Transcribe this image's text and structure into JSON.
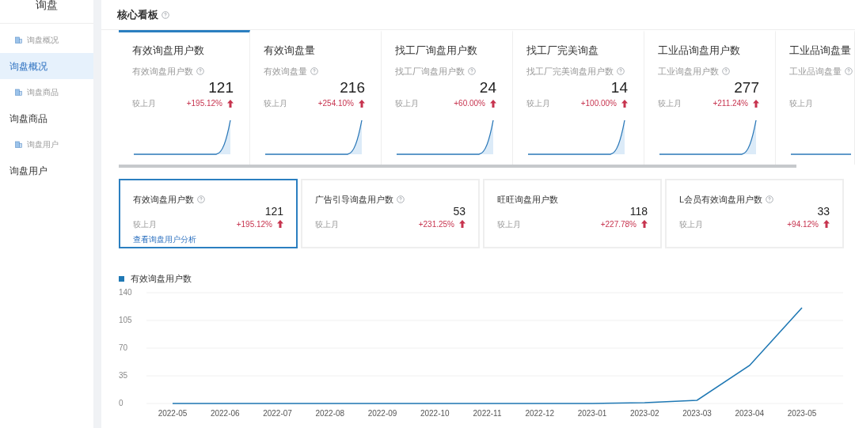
{
  "sidebar": {
    "title": "询盘",
    "items": [
      {
        "label": "询盘概况",
        "kind": "sub",
        "selected": false
      },
      {
        "label": "询盘概况",
        "kind": "main",
        "selected": true
      },
      {
        "label": "询盘商品",
        "kind": "sub",
        "selected": false
      },
      {
        "label": "询盘商品",
        "kind": "main",
        "selected": false
      },
      {
        "label": "询盘用户",
        "kind": "sub",
        "selected": false
      },
      {
        "label": "询盘用户",
        "kind": "main",
        "selected": false
      }
    ]
  },
  "header": {
    "title": "核心看板"
  },
  "metric_cards": [
    {
      "title": "有效询盘用户数",
      "subtitle": "有效询盘用户数",
      "value": "121",
      "compare_label": "较上月",
      "change": "+195.12%",
      "selected": true
    },
    {
      "title": "有效询盘量",
      "subtitle": "有效询盘量",
      "value": "216",
      "compare_label": "较上月",
      "change": "+254.10%",
      "selected": false
    },
    {
      "title": "找工厂询盘用户数",
      "subtitle": "找工厂询盘用户数",
      "value": "24",
      "compare_label": "较上月",
      "change": "+60.00%",
      "selected": false
    },
    {
      "title": "找工厂完美询盘",
      "subtitle": "找工厂完美询盘用户数",
      "value": "14",
      "compare_label": "较上月",
      "change": "+100.00%",
      "selected": false
    },
    {
      "title": "工业品询盘用户数",
      "subtitle": "工业询盘用户数",
      "value": "277",
      "compare_label": "较上月",
      "change": "+211.24%",
      "selected": false
    },
    {
      "title": "工业品询盘量",
      "subtitle": "工业品询盘量",
      "compare_label": "较上月",
      "selected": false
    }
  ],
  "detail_cards": [
    {
      "title": "有效询盘用户数",
      "help": true,
      "value": "121",
      "compare_label": "较上月",
      "change": "+195.12%",
      "link": "查看询盘用户分析",
      "selected": true
    },
    {
      "title": "广告引导询盘用户数",
      "help": true,
      "value": "53",
      "compare_label": "较上月",
      "change": "+231.25%",
      "selected": false
    },
    {
      "title": "旺旺询盘用户数",
      "help": false,
      "value": "118",
      "compare_label": "较上月",
      "change": "+227.78%",
      "selected": false
    },
    {
      "title": "L会员有效询盘用户数",
      "help": true,
      "value": "33",
      "compare_label": "较上月",
      "change": "+94.12%",
      "selected": false
    }
  ],
  "chart": {
    "chart_data": {
      "type": "line",
      "categories": [
        "2022-05",
        "2022-06",
        "2022-07",
        "2022-08",
        "2022-09",
        "2022-10",
        "2022-11",
        "2022-12",
        "2023-01",
        "2023-02",
        "2023-03",
        "2023-04",
        "2023-05"
      ],
      "series": [
        {
          "name": "有效询盘用户数",
          "color": "#1f78b4",
          "values": [
            0,
            0,
            0,
            0,
            0,
            0,
            0,
            0,
            0,
            1,
            4,
            48,
            121
          ]
        }
      ],
      "ylim": [
        0,
        140
      ],
      "grid": true,
      "yticks": [
        0,
        35,
        70,
        105,
        140
      ]
    }
  }
}
